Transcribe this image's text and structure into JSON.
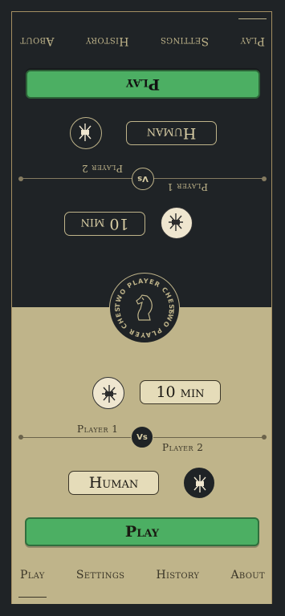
{
  "nav": {
    "items": [
      {
        "label": "Play",
        "active": true
      },
      {
        "label": "Settings",
        "active": false
      },
      {
        "label": "History",
        "active": false
      },
      {
        "label": "About",
        "active": false
      }
    ]
  },
  "play_button": {
    "label": "Play"
  },
  "match": {
    "time": "10 min",
    "player_type": "Human",
    "player1": "Player 1",
    "player2": "Player 2",
    "vs": "Vs"
  },
  "logo": {
    "text": "TWO PLAYER CHESS"
  },
  "colors": {
    "dark_bg": "#1f2326",
    "light_bg": "#bfb48a",
    "accent_gold": "#bfb48a",
    "button_green": "#4caf63"
  }
}
